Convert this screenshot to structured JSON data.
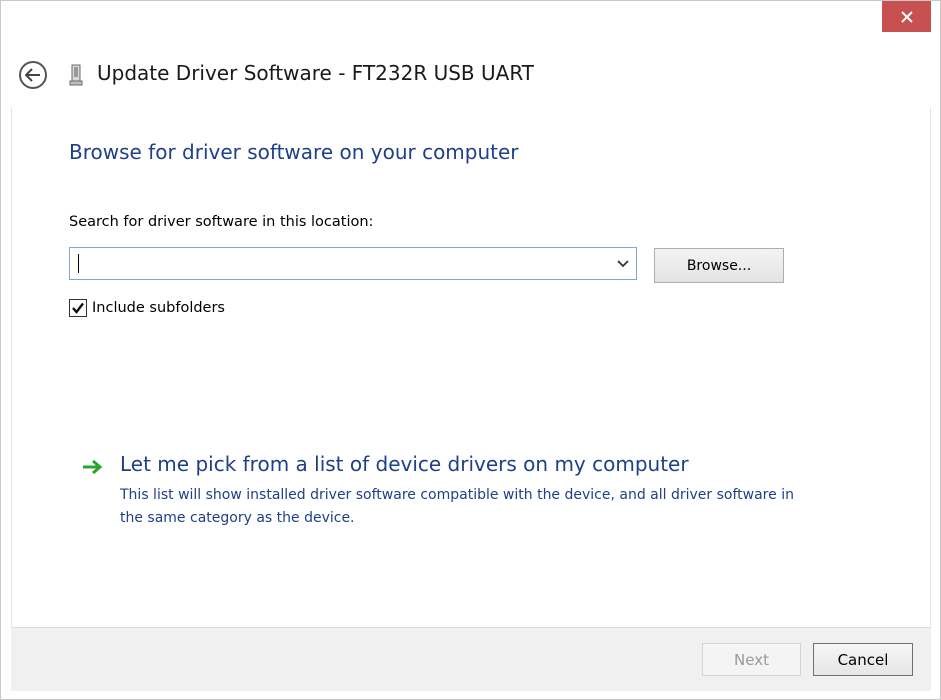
{
  "window": {
    "title": "Update Driver Software - FT232R USB UART",
    "close_icon": "close-icon",
    "back_icon": "back-arrow-icon",
    "device_icon": "usb-device-icon"
  },
  "main": {
    "heading": "Browse for driver software on your computer",
    "search_label": "Search for driver software in this location:",
    "path_value": "",
    "browse_label": "Browse...",
    "include_subfolders_label": "Include subfolders",
    "include_subfolders_checked": true,
    "pick_title": "Let me pick from a list of device drivers on my computer",
    "pick_description": "This list will show installed driver software compatible with the device, and all driver software in the same category as the device."
  },
  "footer": {
    "next_label": "Next",
    "next_enabled": false,
    "cancel_label": "Cancel"
  },
  "colors": {
    "close_red": "#c75050",
    "link_blue": "#1e3f8a",
    "arrow_green": "#2aa52a"
  }
}
